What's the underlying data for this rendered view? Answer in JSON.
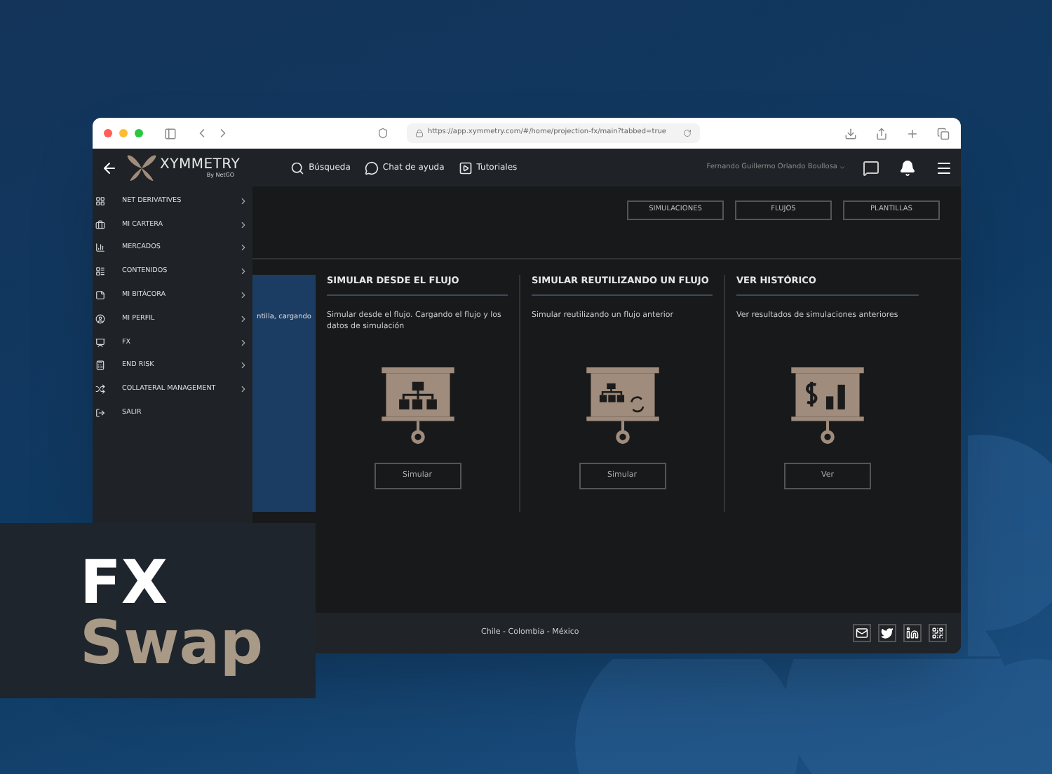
{
  "browser": {
    "url": "https://app.xymmetry.com/#/home/projection-fx/main?tabbed=true"
  },
  "header": {
    "brand": "XYMMETRY",
    "tagline": "By NetGO",
    "user": "Fernando Guillermo Orlando Boullosa",
    "nav": [
      {
        "label": "Búsqueda",
        "kind": "search"
      },
      {
        "label": "Chat de ayuda",
        "kind": "chat"
      },
      {
        "label": "Tutoriales",
        "kind": "video"
      }
    ]
  },
  "menu": [
    {
      "label": "NET DERIVATIVES",
      "kind": "grid",
      "submenu": true
    },
    {
      "label": "MI CARTERA",
      "kind": "briefcase",
      "submenu": true
    },
    {
      "label": "MERCADOS",
      "kind": "bars",
      "submenu": true
    },
    {
      "label": "CONTENIDOS",
      "kind": "list",
      "submenu": true
    },
    {
      "label": "MI BITÁCORA",
      "kind": "note",
      "submenu": true
    },
    {
      "label": "MI PERFIL",
      "kind": "user",
      "submenu": true
    },
    {
      "label": "FX",
      "kind": "board",
      "submenu": true
    },
    {
      "label": "END RISK",
      "kind": "calc",
      "submenu": true
    },
    {
      "label": "COLLATERAL MANAGEMENT",
      "kind": "shuffle",
      "submenu": true
    },
    {
      "label": "SALIR",
      "kind": "logout",
      "submenu": false
    }
  ],
  "tabs": [
    {
      "label": "SIMULACIONES"
    },
    {
      "label": "FLUJOS"
    },
    {
      "label": "PLANTILLAS"
    }
  ],
  "hidden_card": {
    "text": "ntilla, cargando"
  },
  "cards": [
    {
      "kind": "flow",
      "title": "SIMULAR DESDE EL FLUJO",
      "description": "Simular desde el flujo. Cargando el flujo y los datos de simulación",
      "button": "Simular"
    },
    {
      "kind": "reuse",
      "title": "SIMULAR REUTILIZANDO UN FLUJO",
      "description": "Simular reutilizando un flujo anterior",
      "button": "Simular"
    },
    {
      "kind": "history",
      "title": "VER HISTÓRICO",
      "description": "Ver resultados de simulaciones anteriores",
      "button": "Ver"
    }
  ],
  "footer": {
    "countries": "Chile - Colombia - México"
  },
  "overlay": {
    "line_1": "FX",
    "line_2": "Swap"
  }
}
